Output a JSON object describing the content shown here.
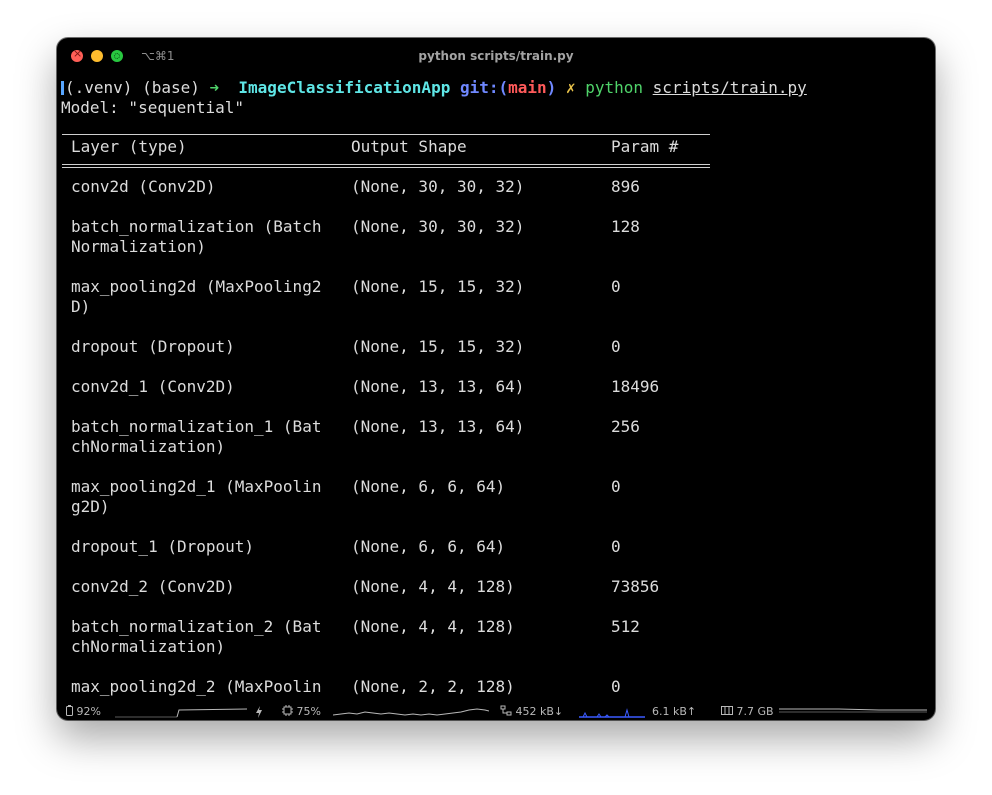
{
  "window": {
    "shortcut": "⌥⌘1",
    "title": "python scripts/train.py"
  },
  "prompt": {
    "venv": "(.venv) (base)",
    "arrow": "➜",
    "directory": "ImageClassificationApp",
    "git_label": "git:(",
    "branch": "main",
    "git_close": ")",
    "dirty_marker": "✗",
    "command": "python",
    "argument": "scripts/train.py"
  },
  "output": {
    "model_line": "Model: \"sequential\""
  },
  "table": {
    "headers": [
      "Layer (type)",
      "Output Shape",
      "Param #"
    ],
    "rows": [
      {
        "layer": "conv2d (Conv2D)",
        "shape": "(None, 30, 30, 32)",
        "params": "896"
      },
      {
        "layer": "batch_normalization (Batch\nNormalization)",
        "shape": "(None, 30, 30, 32)",
        "params": "128"
      },
      {
        "layer": "max_pooling2d (MaxPooling2\nD)",
        "shape": "(None, 15, 15, 32)",
        "params": "0"
      },
      {
        "layer": "dropout (Dropout)",
        "shape": "(None, 15, 15, 32)",
        "params": "0"
      },
      {
        "layer": "conv2d_1 (Conv2D)",
        "shape": "(None, 13, 13, 64)",
        "params": "18496"
      },
      {
        "layer": "batch_normalization_1 (Bat\nchNormalization)",
        "shape": "(None, 13, 13, 64)",
        "params": "256"
      },
      {
        "layer": "max_pooling2d_1 (MaxPoolin\ng2D)",
        "shape": "(None, 6, 6, 64)",
        "params": "0"
      },
      {
        "layer": "dropout_1 (Dropout)",
        "shape": "(None, 6, 6, 64)",
        "params": "0"
      },
      {
        "layer": "conv2d_2 (Conv2D)",
        "shape": "(None, 4, 4, 128)",
        "params": "73856"
      },
      {
        "layer": "batch_normalization_2 (Bat\nchNormalization)",
        "shape": "(None, 4, 4, 128)",
        "params": "512"
      },
      {
        "layer": "max_pooling2d_2 (MaxPoolin",
        "shape": "(None, 2, 2, 128)",
        "params": "0"
      }
    ]
  },
  "statusbar": {
    "battery": "92%",
    "cpu": "75%",
    "net_down": "452 kB↓",
    "net_up": "6.1 kB↑",
    "memory": "7.7 GB",
    "battery_icon": "battery-icon",
    "charging_icon": "bolt-icon",
    "cpu_icon": "cpu-icon",
    "network_icon": "network-icon",
    "memory_icon": "memory-icon"
  },
  "colors": {
    "background": "#000000",
    "text": "#dcdcdc",
    "arrow": "#4fd36a",
    "directory": "#5fe6e6",
    "git": "#6f88ff",
    "branch": "#ff5a5a",
    "dirty": "#e8c24a",
    "network_graph": "#3b5bff"
  }
}
